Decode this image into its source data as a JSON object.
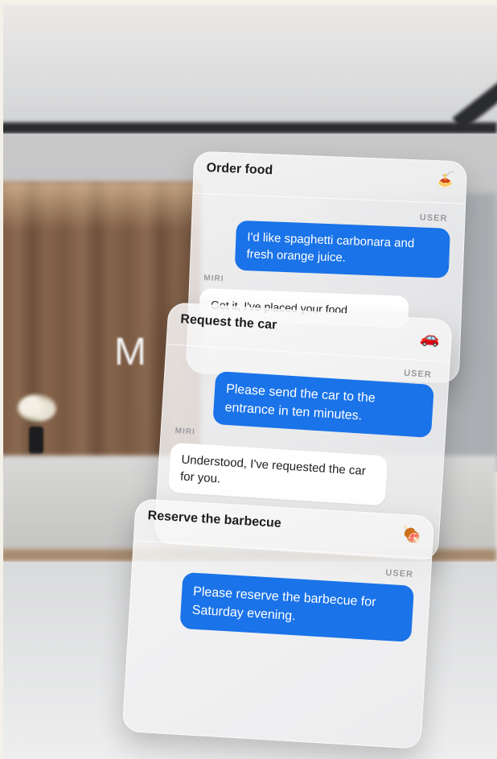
{
  "background": {
    "sign_letter": "M"
  },
  "cards": [
    {
      "title": "Order food",
      "icon": "spaghetti-icon",
      "icon_glyph": "🍝",
      "user_label": "USER",
      "user_message": "I'd like spaghetti carbonara and fresh orange juice.",
      "assistant_label": "MIRI",
      "assistant_message": "Got it, I've placed your food"
    },
    {
      "title": "Request the car",
      "icon": "car-icon",
      "icon_glyph": "🚗",
      "user_label": "USER",
      "user_message": "Please send the car to the entrance in ten minutes.",
      "assistant_label": "MIRI",
      "assistant_message": "Understood, I've requested the car for you."
    },
    {
      "title": "Reserve the barbecue",
      "icon": "barbecue-icon",
      "icon_glyph": "🍖",
      "user_label": "USER",
      "user_message": "Please reserve the barbecue for Saturday evening."
    }
  ],
  "colors": {
    "user_bubble": "#1a73e8",
    "assistant_bubble": "#ffffff",
    "title_text": "#1d1d1f"
  }
}
